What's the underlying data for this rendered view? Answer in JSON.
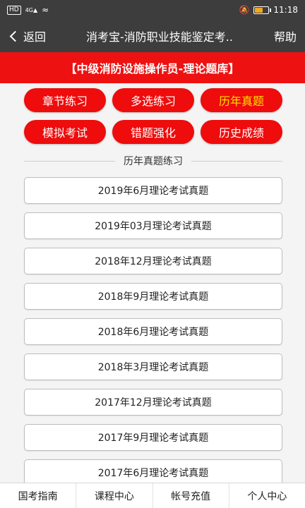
{
  "status_bar": {
    "hd": "HD",
    "signal": "4G",
    "time": "11:18",
    "battery_level": 0.55
  },
  "nav": {
    "back_label": "返回",
    "title": "消考宝-消防职业技能鉴定考..",
    "help_label": "帮助"
  },
  "banner": {
    "title": "【中级消防设施操作员-理论题库】"
  },
  "buttons": [
    {
      "label": "章节练习",
      "active": false
    },
    {
      "label": "多选练习",
      "active": false
    },
    {
      "label": "历年真题",
      "active": true
    },
    {
      "label": "模拟考试",
      "active": false
    },
    {
      "label": "错题强化",
      "active": false
    },
    {
      "label": "历史成绩",
      "active": false
    }
  ],
  "section": {
    "title": "历年真题练习"
  },
  "exams": [
    "2019年6月理论考试真题",
    "2019年03月理论考试真题",
    "2018年12月理论考试真题",
    "2018年9月理论考试真题",
    "2018年6月理论考试真题",
    "2018年3月理论考试真题",
    "2017年12月理论考试真题",
    "2017年9月理论考试真题",
    "2017年6月理论考试真题"
  ],
  "tabs": [
    "国考指南",
    "课程中心",
    "帐号充值",
    "个人中心"
  ],
  "colors": {
    "primary_red": "#ee0c0c",
    "active_text": "#ffe000",
    "nav_bg": "#3d3d3d"
  }
}
